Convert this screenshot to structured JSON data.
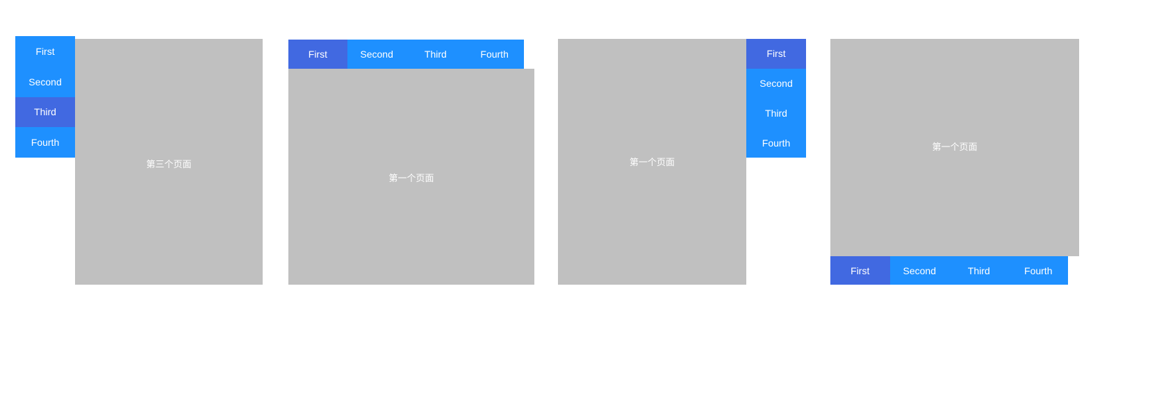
{
  "theme": {
    "tab_inactive_color": "#1e90ff",
    "tab_active_color": "#4169e1",
    "tab_text_color": "#ffffff",
    "content_background_color": "#c0c0c0",
    "content_text_color": "#ffffff",
    "page_background_color": "#ffffff"
  },
  "panels": [
    {
      "id": "tabs-left",
      "tab_position": "left",
      "orientation": "vertical",
      "active_index": 2,
      "tabs": [
        {
          "label": "First"
        },
        {
          "label": "Second"
        },
        {
          "label": "Third"
        },
        {
          "label": "Fourth"
        }
      ],
      "content": {
        "text": "第三个页面"
      }
    },
    {
      "id": "tabs-top",
      "tab_position": "top",
      "orientation": "horizontal",
      "active_index": 0,
      "tabs": [
        {
          "label": "First"
        },
        {
          "label": "Second"
        },
        {
          "label": "Third"
        },
        {
          "label": "Fourth"
        }
      ],
      "content": {
        "text": "第一个页面"
      }
    },
    {
      "id": "tabs-right",
      "tab_position": "right",
      "orientation": "vertical",
      "active_index": 0,
      "tabs": [
        {
          "label": "First"
        },
        {
          "label": "Second"
        },
        {
          "label": "Third"
        },
        {
          "label": "Fourth"
        }
      ],
      "content": {
        "text": "第一个页面"
      }
    },
    {
      "id": "tabs-bottom",
      "tab_position": "bottom",
      "orientation": "horizontal",
      "active_index": 0,
      "tabs": [
        {
          "label": "First"
        },
        {
          "label": "Second"
        },
        {
          "label": "Third"
        },
        {
          "label": "Fourth"
        }
      ],
      "content": {
        "text": "第一个页面"
      }
    }
  ]
}
